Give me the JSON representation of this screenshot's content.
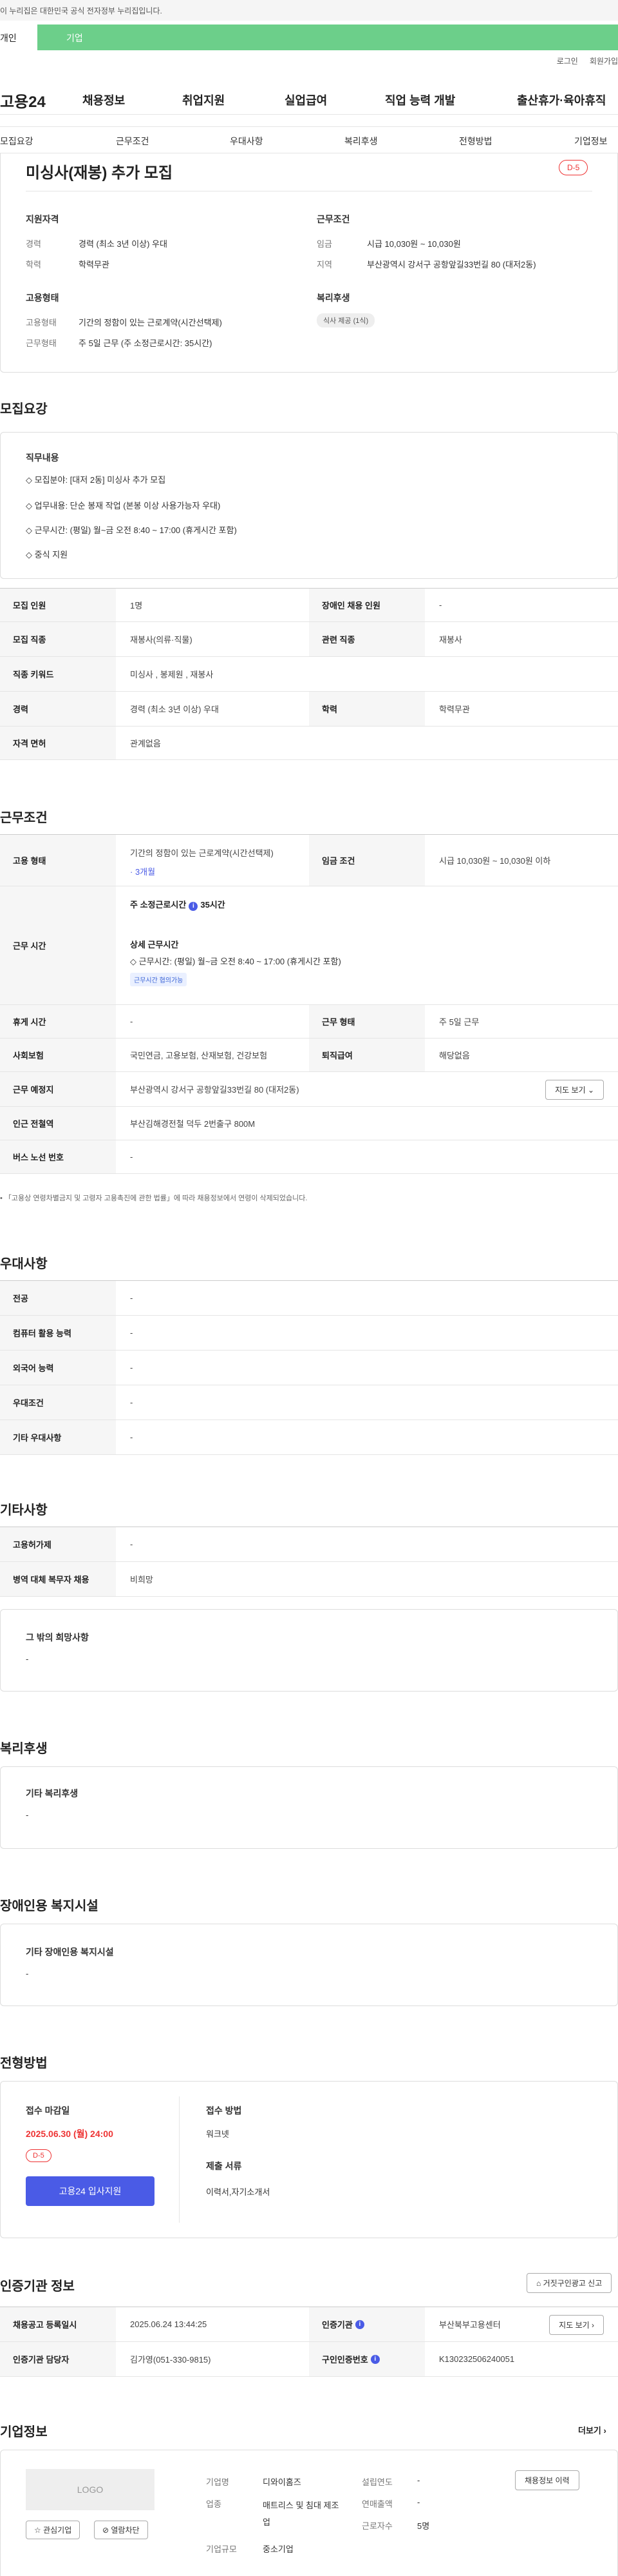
{
  "gov_banner": "이 누리집은 대한민국 공식 전자정부 누리집입니다.",
  "tabs": {
    "a": "개인",
    "b": "기업"
  },
  "util": {
    "login": "로그인",
    "join": "회원가입"
  },
  "logo": "고용24",
  "gnb": [
    "채용정보",
    "취업지원",
    "실업급여",
    "직업 능력 개발",
    "출산휴가·육아휴직"
  ],
  "subnav": [
    "모집요강",
    "근무조건",
    "우대사항",
    "복리후생",
    "전형방법",
    "기업정보"
  ],
  "job": {
    "title": "미싱사(재봉) 추가 모집",
    "dday": "D-5",
    "qual_title": "지원자격",
    "career_k": "경력",
    "career_v": "경력 (최소 3년 이상) 우대",
    "edu_k": "학력",
    "edu_v": "학력무관",
    "cond_title": "근무조건",
    "wage_k": "임금",
    "wage_v": "시급 10,030원 ~ 10,030원",
    "region_k": "지역",
    "region_v": "부산광역시 강서구 공항앞길33번길 80 (대저2동)",
    "form_title": "고용형태",
    "form_k": "고용형태",
    "form_v": "기간의 정함이 있는 근로계약(시간선택제)",
    "type_k": "근무형태",
    "type_v": "주 5일 근무 (주 소정근로시간: 35시간)",
    "welfare_title": "복리후생",
    "welfare_chip": "식사 제공 (1식)"
  },
  "recruit": {
    "title": "모집요강",
    "duty_title": "직무내용",
    "duties": [
      "◇ 모집분야: [대저 2동] 미싱사 추가 모집",
      "◇ 업무내용: 단순 봉재 작업 (본봉 이상 사용가능자 우대)",
      "◇ 근무시간: (평일) 월~금 오전 8:40 ~ 17:00 (휴게시간 포함)",
      "◇ 중식 지원"
    ],
    "rows": [
      {
        "k1": "모집 인원",
        "v1": "1명",
        "k2": "장애인 채용 인원",
        "v2": "-"
      },
      {
        "k1": "모집 직종",
        "v1": "재봉사(의류·직물)",
        "k2": "관련 직종",
        "v2": "재봉사"
      },
      {
        "k1": "직종 키워드",
        "v1": "미싱사 , 봉제원 , 재봉사"
      },
      {
        "k1": "경력",
        "v1": "경력 (최소 3년 이상) 우대",
        "k2": "학력",
        "v2": "학력무관"
      },
      {
        "k1": "자격 면허",
        "v1": "관계없음"
      }
    ]
  },
  "work": {
    "title": "근무조건",
    "form_k": "고용 형태",
    "form_v": "기간의 정함이 있는 근로계약(시간선택제)",
    "form_sub": "· 3개월",
    "wage_k": "임금 조건",
    "wage_v": "시급 10,030원 ~ 10,030원 이하",
    "time_k": "근무 시간",
    "weekly": "주 소정근로시간",
    "weekly_v": "35시간",
    "detail_title": "상세 근무시간",
    "detail_v": "◇ 근무시간: (평일) 월~금 오전 8:40 ~ 17:00 (휴게시간 포함)",
    "time_chip": "근무시간 협의가능",
    "rest_k": "휴게 시간",
    "rest_v": "-",
    "shape_k": "근무 형태",
    "shape_v": "주 5일 근무",
    "ins_k": "사회보험",
    "ins_v": "국민연금, 고용보험, 산재보험, 건강보험",
    "ret_k": "퇴직급여",
    "ret_v": "해당없음",
    "place_k": "근무 예정지",
    "place_v": "부산광역시 강서구 공항앞길33번길 80 (대저2동)",
    "map_btn": "지도 보기",
    "subway_k": "인근 전철역",
    "subway_v": "부산김해경전철 덕두 2번출구 800M",
    "bus_k": "버스 노선 번호",
    "bus_v": "-",
    "note": "「고용상 연령차별금지 및 고령자 고용촉진에 관한 법률」에 따라 채용정보에서 연령이 삭제되었습니다."
  },
  "pref": {
    "title": "우대사항",
    "rows": [
      {
        "k": "전공",
        "v": "-"
      },
      {
        "k": "컴퓨터 활용 능력",
        "v": "-"
      },
      {
        "k": "외국어 능력",
        "v": "-"
      },
      {
        "k": "우대조건",
        "v": "-"
      },
      {
        "k": "기타 우대사항",
        "v": "-"
      }
    ]
  },
  "etc": {
    "title": "기타사항",
    "rows": [
      {
        "k": "고용허가제",
        "v": "-"
      },
      {
        "k": "병역 대체 복무자 채용",
        "v": "비희망"
      }
    ],
    "wish_title": "그 밖의 희망사항",
    "wish_v": "-"
  },
  "welfare": {
    "title": "복리후생",
    "box_title": "기타 복리후생",
    "box_v": "-"
  },
  "disab": {
    "title": "장애인용 복지시설",
    "box_title": "기타 장애인용 복지시설",
    "box_v": "-"
  },
  "screen": {
    "title": "전형방법",
    "deadline_title": "접수 마감일",
    "deadline_v": "2025.06.30 (월) 24:00",
    "dday": "D-5",
    "apply_btn": "고용24 입사지원",
    "method_title": "접수 방법",
    "method_v": "워크넷",
    "docs_title": "제출 서류",
    "docs_v": "이력서,자기소개서"
  },
  "agency": {
    "title": "인증기관 정보",
    "report_btn": "거짓구인광고 신고",
    "date_k": "채용공고 등록일시",
    "date_v": "2025.06.24 13:44:25",
    "org_k": "인증기관",
    "org_v": "부산북부고용센터",
    "map_btn": "지도 보기",
    "mgr_k": "인증기관 담당자",
    "mgr_v": "김가영(051-330-9815)",
    "no_k": "구인인증번호",
    "no_v": "K130232506240051"
  },
  "company": {
    "title": "기업정보",
    "more": "더보기",
    "logo": "LOGO",
    "fav_btn": "관심기업",
    "block_btn": "열람차단",
    "name_k": "기업명",
    "name_v": "디와이홈즈",
    "ind_k": "업종",
    "ind_v": "매트리스 및 침대 제조업",
    "size_k": "기업규모",
    "size_v": "중소기업",
    "est_k": "설립연도",
    "est_v": "-",
    "sales_k": "연매출액",
    "sales_v": "-",
    "emp_k": "근로자수",
    "emp_v": "5명",
    "hist_btn": "채용정보 이력"
  }
}
